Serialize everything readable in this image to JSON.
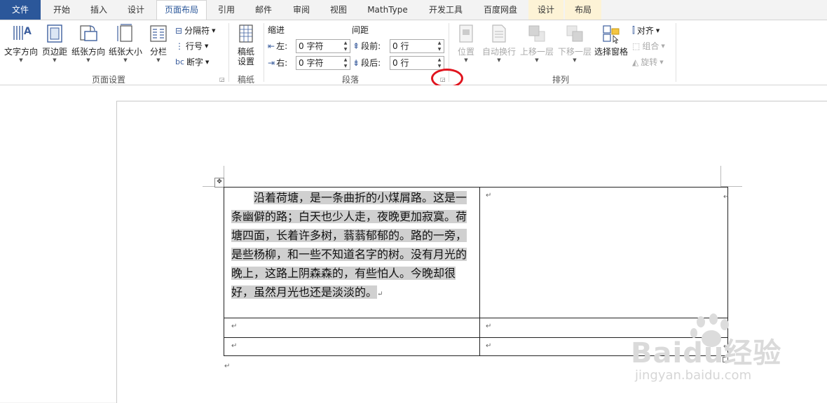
{
  "tabs": {
    "file": "文件",
    "home": "开始",
    "insert": "插入",
    "design": "设计",
    "page_layout": "页面布局",
    "references": "引用",
    "mailings": "邮件",
    "review": "审阅",
    "view": "视图",
    "mathtype": "MathType",
    "developer": "开发工具",
    "baidu_netdisk": "百度网盘",
    "table_design": "设计",
    "table_layout": "布局"
  },
  "page_setup": {
    "text_direction": "文字方向",
    "margins": "页边距",
    "orientation": "纸张方向",
    "size": "纸张大小",
    "columns": "分栏",
    "breaks": "分隔符",
    "line_numbers": "行号",
    "hyphenation": "断字",
    "group_label": "页面设置"
  },
  "draft": {
    "line1": "稿纸",
    "line2": "设置",
    "group_label": "稿纸"
  },
  "paragraph": {
    "indent_label": "缩进",
    "spacing_label": "间距",
    "left_label": "左:",
    "right_label": "右:",
    "before_label": "段前:",
    "after_label": "段后:",
    "left_value": "0 字符",
    "right_value": "0 字符",
    "before_value": "0 行",
    "after_value": "0 行",
    "group_label": "段落"
  },
  "arrange": {
    "position": "位置",
    "wrap_text": "自动换行",
    "bring_forward": "上移一层",
    "send_backward": "下移一层",
    "selection_pane": "选择窗格",
    "align": "对齐",
    "group": "组合",
    "rotate": "旋转",
    "group_label": "排列"
  },
  "document": {
    "paragraph_text": "沿着荷塘，是一条曲折的小煤屑路。这是一条幽僻的路；白天也少人走，夜晚更加寂寞。荷塘四面，长着许多树，蓊蓊郁郁的。路的一旁，是些杨柳，和一些不知道名字的树。没有月光的晚上，这路上阴森森的，有些怕人。今晚却很好，虽然月光也还是淡淡的。",
    "return_mark": "↵",
    "move_handle": "✥"
  },
  "watermark": {
    "brand": "Baidu经验",
    "url": "jingyan.baidu.com"
  },
  "colors": {
    "file_tab": "#2b579a",
    "accent": "#2b579a",
    "highlight": "#e0141e",
    "selection": "#d0d0d0"
  }
}
